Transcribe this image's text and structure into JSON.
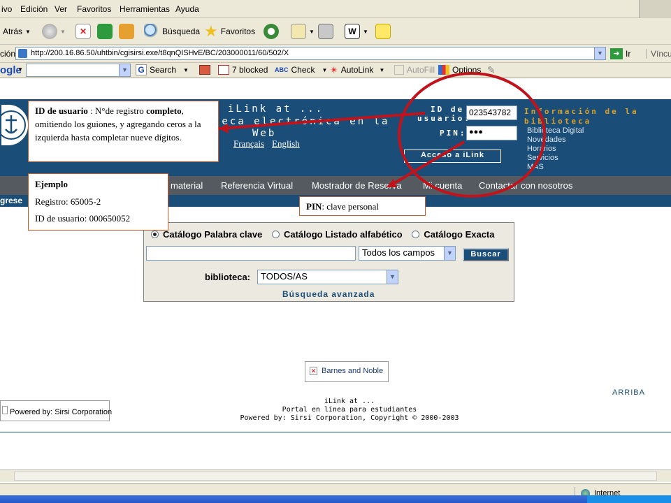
{
  "menu": [
    "ivo",
    "Edición",
    "Ver",
    "Favoritos",
    "Herramientas",
    "Ayuda"
  ],
  "toolbar": {
    "back": "Atrás",
    "search": "Búsqueda",
    "favorites": "Favoritos"
  },
  "address": {
    "label": "ción",
    "url": "http://200.16.86.50/uhtbin/cgisirsi.exe/t8qnQISHvE/BC/203000011/60/502/X",
    "go": "Ir",
    "links": "Víncul"
  },
  "google": {
    "label": "ogle",
    "search": "Search",
    "blocked": "7 blocked",
    "check": "Check",
    "autolink": "AutoLink",
    "autofill": "AutoFill",
    "options": "Options"
  },
  "banner": {
    "line1": "iLink at ...",
    "line2": "teca electrónica en la",
    "line3": "Web",
    "lang1": "Français",
    "lang2": "English"
  },
  "login": {
    "id_label_1": "ID de",
    "id_label_2": "usuario:",
    "id_value": "023543782",
    "pin_label": "PIN:",
    "pin_value": "●●●",
    "button": "Acceso a iLink"
  },
  "info": {
    "title_1": "Información de la",
    "title_2": "biblioteca",
    "links": [
      "Biblioteca Digital",
      "Novedades",
      "Horarios",
      "Servicios",
      "MÁS"
    ]
  },
  "nav": {
    "items": [
      "material",
      "Referencia Virtual",
      "Mostrador de Reserva",
      "Mi cuenta",
      "Contactar con nosotros"
    ],
    "left": "grese"
  },
  "callouts": {
    "id_bold": "ID de usuario",
    "id_sep": " : ",
    "id_text_1": "N°de registro",
    "id_bold_2": "completo",
    "id_text_2": ",  omitiendo los guiones, y agregando ceros a la izquierda hasta completar nueve dígitos.",
    "example_title": "Ejemplo",
    "example_reg": "Registro: 65005-2",
    "example_id": "ID de usuario: 000650052",
    "pin_bold": "PIN",
    "pin_text": ": clave personal"
  },
  "search": {
    "opt1": "Catálogo Palabra clave",
    "opt2": "Catálogo Listado alfabético",
    "opt3": "Catálogo Exacta",
    "field_value": "",
    "fields": "Todos los campos",
    "button": "Buscar",
    "library_label": "biblioteca:",
    "library_value": "TODOS/AS",
    "advanced": "Búsqueda avanzada"
  },
  "footer": {
    "barnes": "Barnes and Noble",
    "arriba": "ARRIBA",
    "powered_box": "Powered by: Sirsi Corporation",
    "line1": "iLink at ...",
    "line2": "Portal en línea para estudiantes",
    "line3": "Powered by: Sirsi Corporation, Copyright © 2000-2003"
  },
  "status": {
    "zone": "Internet"
  },
  "colors": {
    "header": "#1a4e78",
    "nav": "#545a60",
    "gold": "#e0a020",
    "annotation": "#c0141c"
  }
}
